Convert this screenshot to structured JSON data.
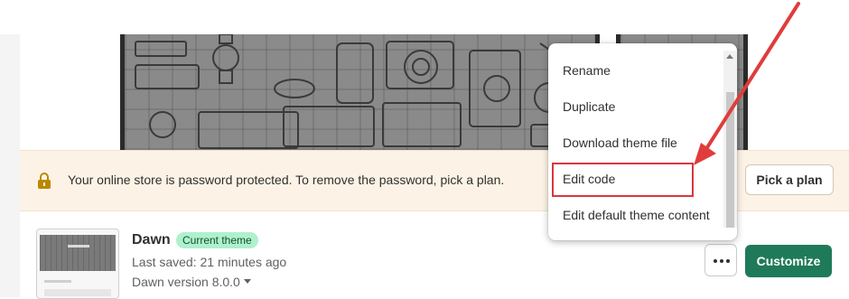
{
  "banner": {
    "icon": "lock-icon",
    "message": "Your online store is password protected. To remove the password, pick a plan.",
    "button_label": "Pick a plan"
  },
  "theme": {
    "name": "Dawn",
    "badge": "Current theme",
    "last_saved": "Last saved: 21 minutes ago",
    "version": "Dawn version 8.0.0"
  },
  "actions": {
    "more_icon": "more-horizontal-icon",
    "customize_label": "Customize"
  },
  "menu": {
    "items": [
      {
        "label": "Rename"
      },
      {
        "label": "Duplicate"
      },
      {
        "label": "Download theme file"
      },
      {
        "label": "Edit code",
        "highlighted": true
      },
      {
        "label": "Edit default theme content"
      }
    ]
  },
  "annotation": {
    "color": "#e03c3c",
    "type": "arrow-pointing-to-edit-code"
  },
  "colors": {
    "banner_bg": "#fcf3e6",
    "badge_bg": "#aff0cd",
    "primary_button": "#1f7a5a"
  }
}
